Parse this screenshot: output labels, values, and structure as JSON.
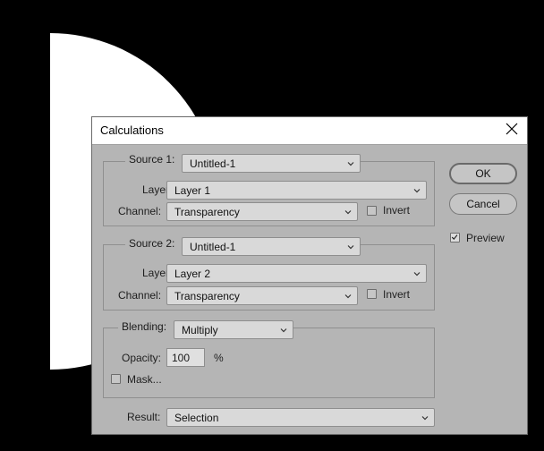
{
  "dialog": {
    "title": "Calculations"
  },
  "source1": {
    "label": "Source 1:",
    "document": "Untitled-1",
    "layer_label": "Layer:",
    "layer": "Layer 1",
    "channel_label": "Channel:",
    "channel": "Transparency",
    "invert_label": "Invert",
    "invert_checked": false
  },
  "source2": {
    "label": "Source 2:",
    "document": "Untitled-1",
    "layer_label": "Layer:",
    "layer": "Layer 2",
    "channel_label": "Channel:",
    "channel": "Transparency",
    "invert_label": "Invert",
    "invert_checked": false
  },
  "blending": {
    "label": "Blending:",
    "mode": "Multiply",
    "opacity_label": "Opacity:",
    "opacity": "100",
    "opacity_unit": "%",
    "mask_label": "Mask...",
    "mask_checked": false
  },
  "result": {
    "label": "Result:",
    "value": "Selection"
  },
  "buttons": {
    "ok": "OK",
    "cancel": "Cancel"
  },
  "preview": {
    "label": "Preview",
    "checked": true
  }
}
